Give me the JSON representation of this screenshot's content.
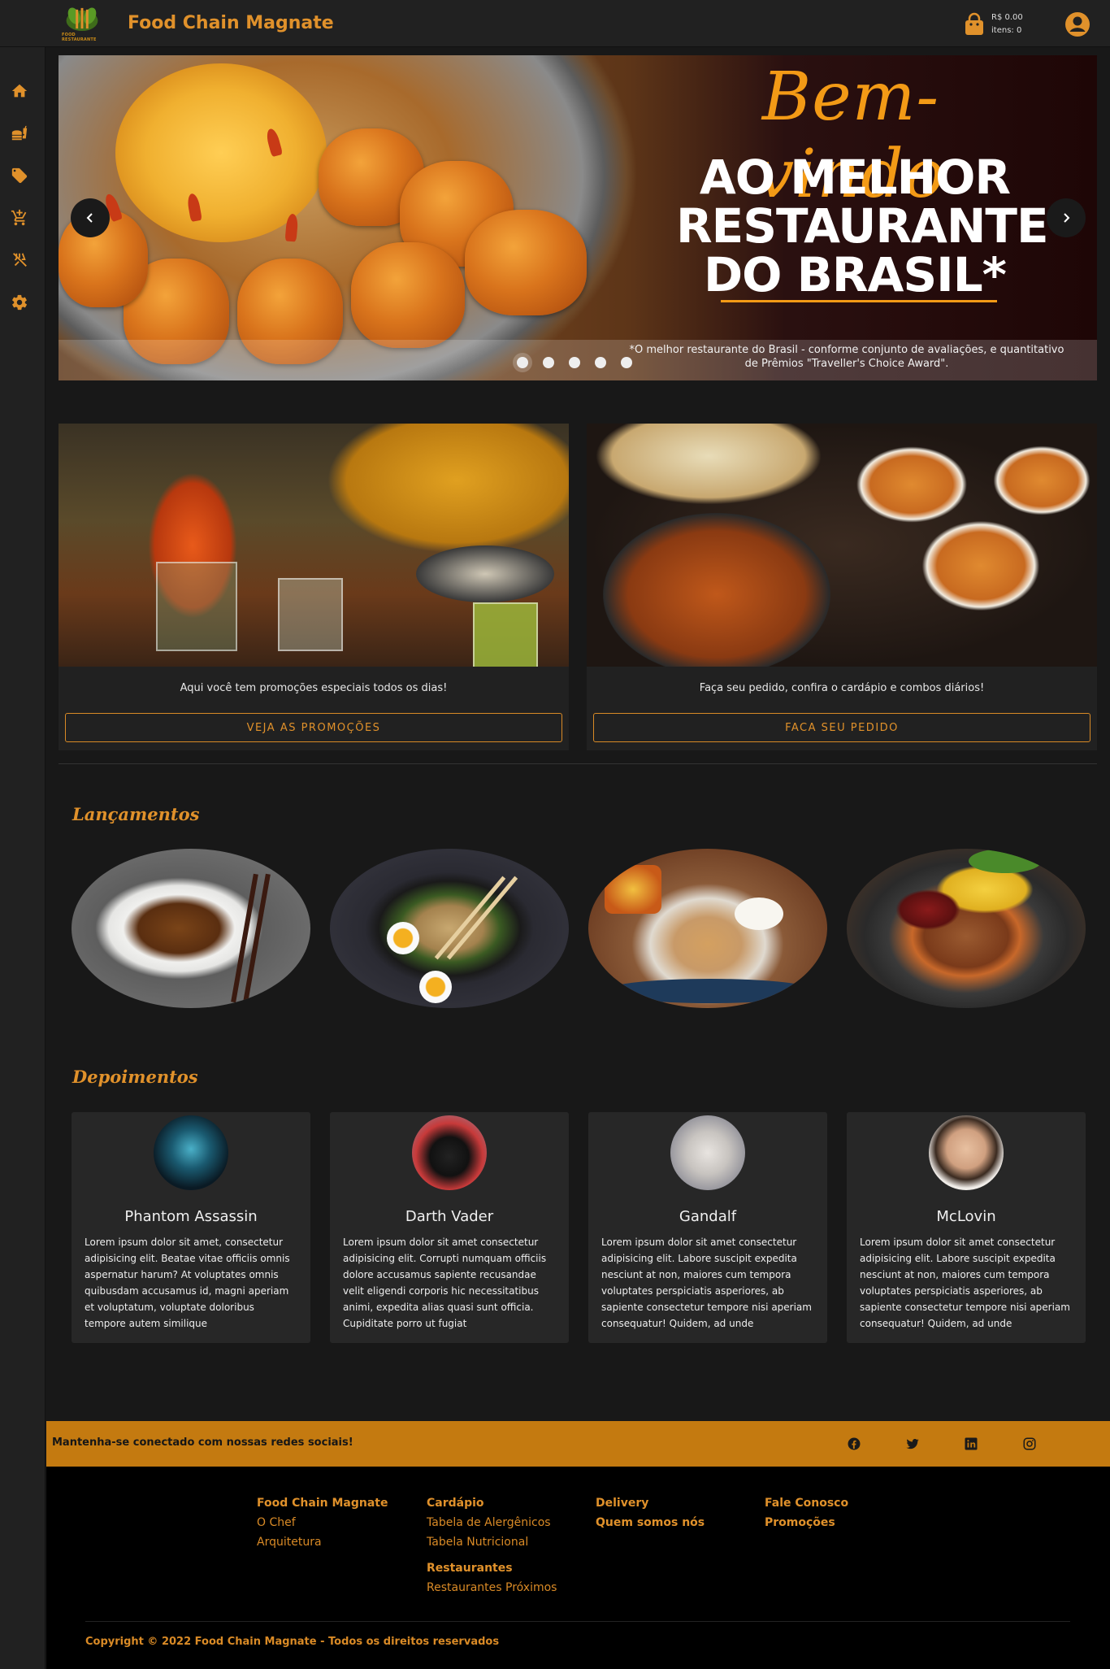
{
  "header": {
    "logo_text": "FOOD RESTAURANTE",
    "title": "Food Chain Magnate",
    "cart_total": "R$ 0.00",
    "cart_items": "itens: 0"
  },
  "sidebar": {
    "items": [
      {
        "icon": "home-icon"
      },
      {
        "icon": "fast-food-icon"
      },
      {
        "icon": "tag-icon"
      },
      {
        "icon": "cart-icon"
      },
      {
        "icon": "no-food-icon"
      },
      {
        "icon": "gear-icon"
      }
    ]
  },
  "hero": {
    "welcome": "Bem-vindo",
    "line1": "AO MELHOR",
    "line2": "RESTAURANTE",
    "line3": "DO BRASIL*",
    "caption": "*O melhor restaurante do Brasil - conforme conjunto de avaliações, e quantitativo de Prêmios \"Traveller's Choice Award\".",
    "slides": 5,
    "active_slide": 1
  },
  "promos": [
    {
      "text": "Aqui você tem promoções especiais todos os dias!",
      "button": "VEJA AS PROMOÇÕES"
    },
    {
      "text": "Faça seu pedido, confira o cardápio e combos diários!",
      "button": "FACA SEU PEDIDO"
    }
  ],
  "launches": {
    "title": "Lançamentos"
  },
  "testimonials": {
    "title": "Depoimentos",
    "items": [
      {
        "name": "Phantom Assassin",
        "text": "Lorem ipsum dolor sit amet, consectetur adipisicing elit. Beatae vitae officiis omnis aspernatur harum? At voluptates omnis quibusdam accusamus id, magni aperiam et voluptatum, voluptate doloribus tempore autem similique"
      },
      {
        "name": "Darth Vader",
        "text": "Lorem ipsum dolor sit amet consectetur adipisicing elit. Corrupti numquam officiis dolore accusamus sapiente recusandae velit eligendi corporis hic necessitatibus animi, expedita alias quasi sunt officia. Cupiditate porro ut fugiat"
      },
      {
        "name": "Gandalf",
        "text": "Lorem ipsum dolor sit amet consectetur adipisicing elit. Labore suscipit expedita nesciunt at non, maiores cum tempora voluptates perspiciatis asperiores, ab sapiente consectetur tempore nisi aperiam consequatur! Quidem, ad unde"
      },
      {
        "name": "McLovin",
        "text": "Lorem ipsum dolor sit amet consectetur adipisicing elit. Labore suscipit expedita nesciunt at non, maiores cum tempora voluptates perspiciatis asperiores, ab sapiente consectetur tempore nisi aperiam consequatur! Quidem, ad unde"
      }
    ]
  },
  "social": {
    "text": "Mantenha-se conectado com nossas redes sociais!",
    "icons": [
      "facebook-icon",
      "twitter-icon",
      "linkedin-icon",
      "instagram-icon"
    ]
  },
  "footer": {
    "col1": {
      "head": "Food Chain Magnate",
      "links": [
        "O Chef",
        "Arquitetura"
      ]
    },
    "col2": {
      "head": "Cardápio",
      "links": [
        "Tabela de Alergênicos",
        "Tabela Nutricional"
      ],
      "head2": "Restaurantes",
      "links2": [
        "Restaurantes Próximos"
      ]
    },
    "col3": {
      "head": "Delivery",
      "head2": "Quem somos nós"
    },
    "col4": {
      "head": "Fale Conosco",
      "head2": "Promoções"
    },
    "copyright": "Copyright © 2022 Food Chain Magnate - Todos os direitos reservados"
  },
  "colors": {
    "accent": "#e0912b",
    "social_band": "#c47a10",
    "background": "#181818",
    "panel": "#212121"
  }
}
